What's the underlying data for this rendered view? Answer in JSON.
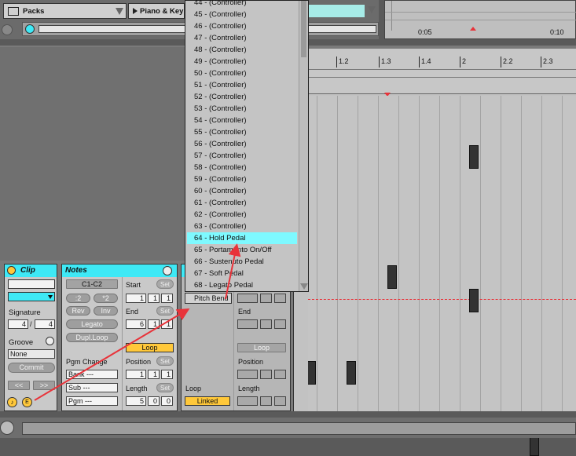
{
  "browser": {
    "packs_label": "Packs",
    "piano_label": "Piano & Key"
  },
  "timeline": {
    "tick1": "0:05",
    "tick2": "0:10"
  },
  "ruler": [
    "1.2",
    "1.3",
    "1.4",
    "2",
    "2.2",
    "2.3"
  ],
  "dropdown": {
    "items": [
      "44 - (Controller)",
      "45 - (Controller)",
      "46 - (Controller)",
      "47 - (Controller)",
      "48 - (Controller)",
      "49 - (Controller)",
      "50 - (Controller)",
      "51 - (Controller)",
      "52 - (Controller)",
      "53 - (Controller)",
      "54 - (Controller)",
      "55 - (Controller)",
      "56 - (Controller)",
      "57 - (Controller)",
      "58 - (Controller)",
      "59 - (Controller)",
      "60 - (Controller)",
      "61 - (Controller)",
      "62 - (Controller)",
      "63 - (Controller)",
      "64 - Hold Pedal",
      "65 - Portamento On/Off",
      "66 - Sustenuto Pedal",
      "67 - Soft Pedal",
      "68 - Legato Pedal"
    ],
    "selected_index": 20
  },
  "clip": {
    "title": "Clip",
    "signature_label": "Signature",
    "sig_num": "4",
    "sig_sep": "/",
    "sig_den": "4",
    "groove_label": "Groove",
    "groove_value": "None",
    "commit": "Commit",
    "nav_left": "<<",
    "nav_right": ">>",
    "badge_e": "E"
  },
  "notes": {
    "title": "Notes",
    "range": "C1-C2",
    "half": ":2",
    "double": "*2",
    "rev": "Rev",
    "inv": "Inv",
    "legato": "Legato",
    "dupl": "Dupl.Loop",
    "pgm_change": "Pgm Change",
    "bank": "Bank ---",
    "sub": "Sub ---",
    "pgm": "Pgm ---",
    "start_label": "Start",
    "end_label": "End",
    "loop_label": "Loop",
    "position_label": "Position",
    "length_label": "Length",
    "set": "Set",
    "start": [
      "1",
      "1",
      "1"
    ],
    "end": [
      "6",
      "1",
      "1"
    ],
    "position": [
      "1",
      "1",
      "1"
    ],
    "length": [
      "5",
      "0",
      "0"
    ]
  },
  "envelope": {
    "control_value": "Pitch Bend",
    "loop_label": "Loop",
    "linked": "Linked",
    "end_label": "End",
    "loop_btn": "Loop",
    "position_label": "Position",
    "length_label": "Length"
  },
  "colors": {
    "cyan": "#3ee9f6",
    "highlight": "#7ef9ff",
    "yellow": "#ffc83a",
    "arrow": "#e8333a"
  }
}
